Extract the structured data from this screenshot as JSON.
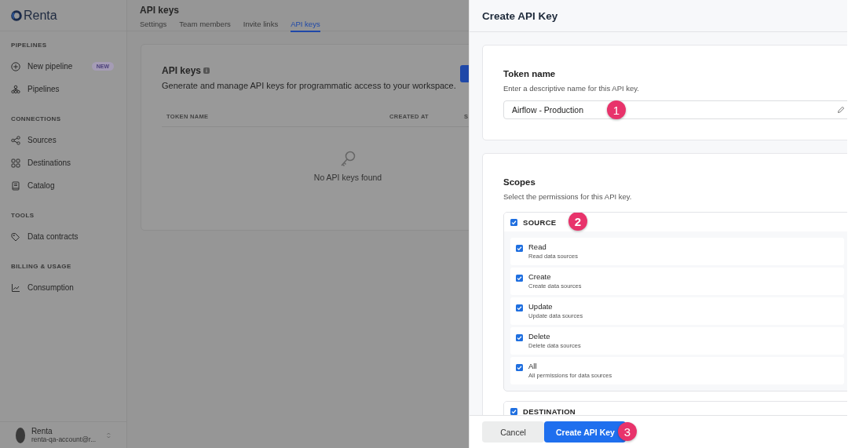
{
  "sidebar": {
    "logo": "Renta",
    "sections": [
      {
        "heading": "PIPELINES",
        "items": [
          {
            "label": "New pipeline",
            "kind": "plus",
            "badge": "NEW"
          },
          {
            "label": "Pipelines",
            "kind": "tree"
          }
        ]
      },
      {
        "heading": "CONNECTIONS",
        "items": [
          {
            "label": "Sources",
            "kind": "share"
          },
          {
            "label": "Destinations",
            "kind": "grid"
          },
          {
            "label": "Catalog",
            "kind": "book"
          }
        ]
      },
      {
        "heading": "TOOLS",
        "items": [
          {
            "label": "Data contracts",
            "kind": "tag"
          }
        ]
      },
      {
        "heading": "BILLING & USAGE",
        "items": [
          {
            "label": "Consumption",
            "kind": "chart"
          }
        ]
      }
    ],
    "user": {
      "name": "Renta",
      "email": "renta-qa-account@r..."
    }
  },
  "page": {
    "title": "API keys",
    "tabs": [
      {
        "label": "Settings",
        "selected": false
      },
      {
        "label": "Team members",
        "selected": false
      },
      {
        "label": "Invite links",
        "selected": false
      },
      {
        "label": "API keys",
        "selected": true
      }
    ],
    "card": {
      "title": "API keys",
      "description": "Generate and manage API keys for programmatic access to your workspace.",
      "columns": [
        "TOKEN NAME",
        "CREATED AT",
        "S"
      ],
      "empty_message": "No API keys found"
    }
  },
  "panel": {
    "title": "Create API Key",
    "token": {
      "label": "Token name",
      "hint": "Enter a descriptive name for this API key.",
      "value": "Airflow - Production",
      "marker": "1"
    },
    "scopes": {
      "label": "Scopes",
      "hint": "Select the permissions for this API key.",
      "groups": [
        {
          "name": "SOURCE",
          "checked": true,
          "marker": "2",
          "permissions": [
            {
              "name": "Read",
              "description": "Read data sources",
              "checked": true
            },
            {
              "name": "Create",
              "description": "Create data sources",
              "checked": true
            },
            {
              "name": "Update",
              "description": "Update data sources",
              "checked": true
            },
            {
              "name": "Delete",
              "description": "Delete data sources",
              "checked": true
            },
            {
              "name": "All",
              "description": "All permissions for data sources",
              "checked": true
            }
          ]
        },
        {
          "name": "DESTINATION",
          "checked": true
        }
      ]
    },
    "buttons": [
      {
        "label": "Cancel",
        "kind": "secondary"
      },
      {
        "label": "Create API Key",
        "kind": "primary",
        "marker": "3"
      }
    ]
  }
}
